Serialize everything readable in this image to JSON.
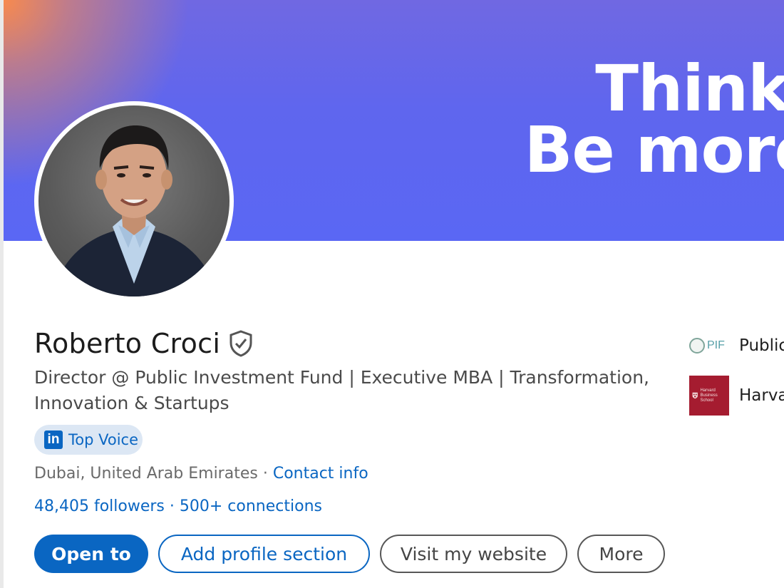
{
  "banner": {
    "line1": "Think diff",
    "line2": "Be more cu"
  },
  "profile": {
    "name": "Roberto Croci",
    "headline": "Director @ Public Investment Fund | Executive MBA | Transformation, Innovation & Startups",
    "badge": {
      "logo": "in",
      "label": "Top Voice"
    },
    "location": "Dubai, United Arab Emirates",
    "location_sep": " · ",
    "contact_info": "Contact info",
    "followers": "48,405 followers",
    "stats_sep": " · ",
    "connections": "500+ connections"
  },
  "actions": {
    "open_to": "Open to",
    "add_section": "Add profile section",
    "visit_website": "Visit my website",
    "more": "More"
  },
  "side": {
    "pif": {
      "logo_text": "PIF",
      "label": "Public"
    },
    "hbs": {
      "logo_text": "Harvard Business School",
      "label": "Harva"
    }
  },
  "colors": {
    "accent": "#0a66c2",
    "banner": "#5a67f4",
    "badge_bg": "#dce7f4",
    "hbs_red": "#a51c30"
  }
}
